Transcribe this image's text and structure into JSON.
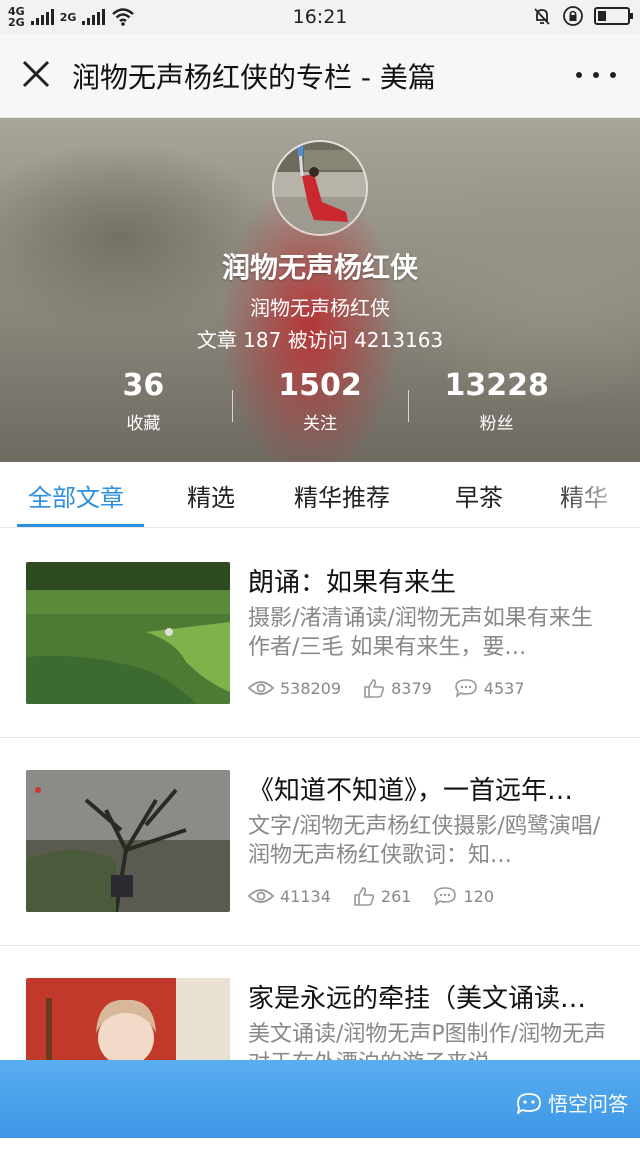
{
  "status_bar": {
    "network_1": "4G",
    "network_2": "2G",
    "network_3": "2G",
    "time": "16:21"
  },
  "title_bar": {
    "title": "润物无声杨红侠的专栏 - 美篇"
  },
  "profile": {
    "name": "润物无声杨红侠",
    "subtitle": "润物无声杨红侠",
    "meta": "文章 187  被访问 4213163",
    "stats": [
      {
        "value": "36",
        "label": "收藏"
      },
      {
        "value": "1502",
        "label": "关注"
      },
      {
        "value": "13228",
        "label": "粉丝"
      }
    ]
  },
  "tabs": [
    {
      "label": "全部文章"
    },
    {
      "label": "精选"
    },
    {
      "label": "精华推荐"
    },
    {
      "label": "早茶"
    },
    {
      "label": "精华"
    }
  ],
  "articles": [
    {
      "title": "朗诵：如果有来生",
      "summary": "摄影/渚清诵读/润物无声如果有来生 作者/三毛 如果有来生，要…",
      "views": "538209",
      "likes": "8379",
      "comments": "4537"
    },
    {
      "title": "《知道不知道》，一首远年…",
      "summary": "文字/润物无声杨红侠摄影/鸥鹭演唱/润物无声杨红侠歌词：知…",
      "views": "41134",
      "likes": "261",
      "comments": "120"
    },
    {
      "title": "家是永远的牵挂（美文诵读…",
      "summary": "美文诵读/润物无声P图制作/润物无声对于在外漂泊的游子来说",
      "views": "",
      "likes": "",
      "comments": ""
    }
  ],
  "banner": {
    "brand": "悟空问答"
  },
  "icons": {
    "close": "close-icon",
    "more": "more-icon",
    "views": "eye-icon",
    "likes": "thumbs-up-icon",
    "comments": "comment-icon"
  },
  "colors": {
    "accent": "#2d8fe0",
    "banner": "#4aa2ea"
  }
}
